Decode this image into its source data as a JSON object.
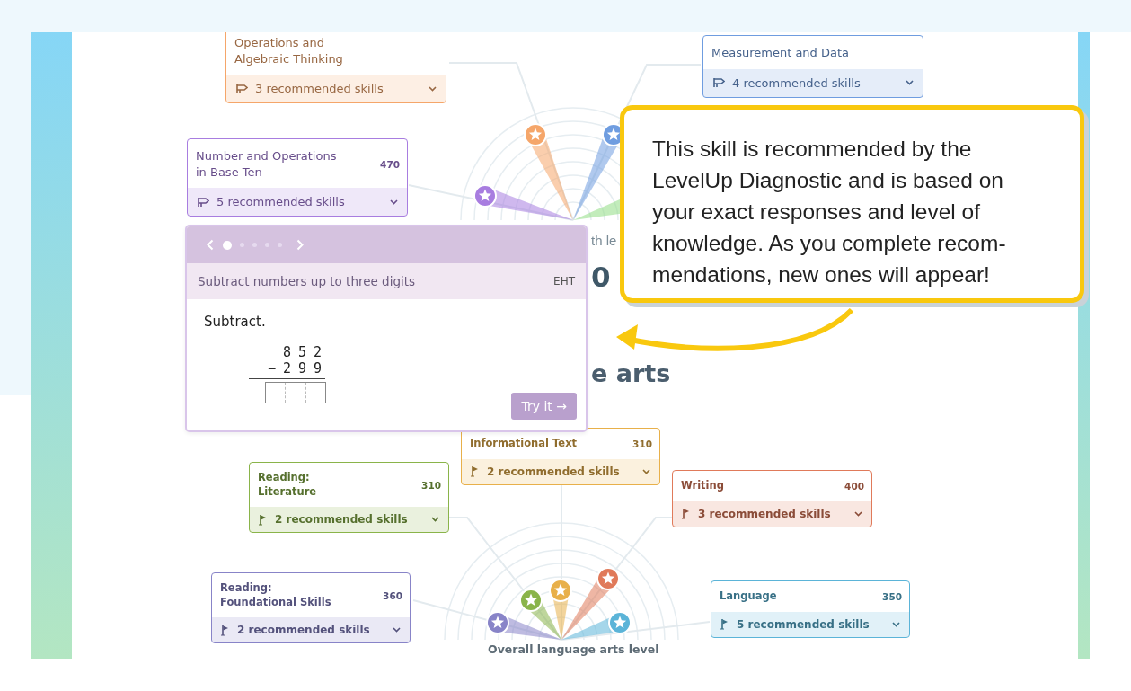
{
  "math_areas": [
    {
      "title": "Operations and\nAlgebraic Thinking",
      "recommended": "3 recommended skills",
      "color": "#f5a66a"
    },
    {
      "title": "Measurement and Data",
      "recommended": "4 recommended skills",
      "color": "#6f9de0"
    },
    {
      "title": "Number and Operations\nin Base Ten",
      "score": "470",
      "recommended": "5 recommended skills",
      "color": "#a87de0"
    }
  ],
  "math_level": {
    "label": "th le",
    "value": "0"
  },
  "popup": {
    "pages": [
      {
        "selected": true
      },
      {
        "selected": false
      },
      {
        "selected": false
      },
      {
        "selected": false
      },
      {
        "selected": false
      }
    ],
    "skill": "Subtract numbers up to three digits",
    "code": "EHT",
    "prompt": "Subtract.",
    "top_digits": [
      "8",
      "5",
      "2"
    ],
    "operator": "−",
    "bottom_digits": [
      "2",
      "9",
      "9"
    ],
    "button": "Try it →"
  },
  "language_heading": "e arts",
  "language_areas": [
    {
      "title": "Informational Text",
      "score": "310",
      "recommended": "2 recommended skills",
      "color": "#e8b04a"
    },
    {
      "title": "Reading:\nLiterature",
      "score": "310",
      "recommended": "2 recommended skills",
      "color": "#8ab44a"
    },
    {
      "title": "Writing",
      "score": "400",
      "recommended": "3 recommended skills",
      "color": "#e07a5a"
    },
    {
      "title": "Reading:\nFoundational Skills",
      "score": "360",
      "recommended": "2 recommended skills",
      "color": "#8884c8"
    },
    {
      "title": "Language",
      "score": "350",
      "recommended": "5 recommended skills",
      "color": "#5bb4d8"
    }
  ],
  "language_level": {
    "label": "Overall language arts level"
  },
  "callout": {
    "text": "This skill is recommended by the\nLevelUp Diagnostic and is based on\nyour exact responses and level of\nknowledge. As you complete recom-\nmendations, new ones will appear!"
  }
}
